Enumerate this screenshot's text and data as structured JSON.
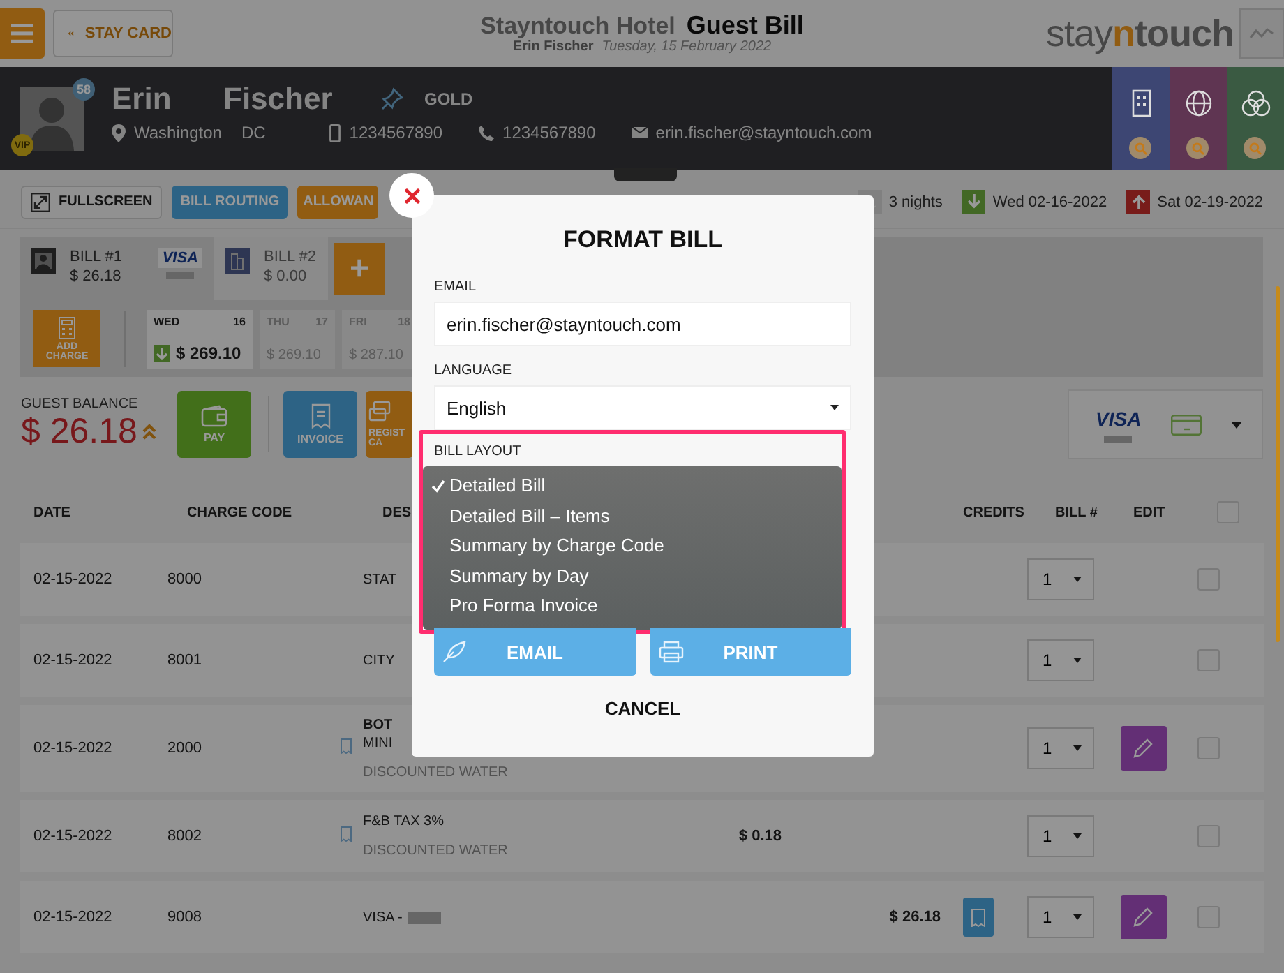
{
  "topbar": {
    "back_button": "STAY CARD",
    "hotel": "Stayntouch Hotel",
    "page_title": "Guest Bill",
    "guest_name": "Erin Fischer",
    "date": "Tuesday, 15 February 2022",
    "logo": [
      "stay",
      "n",
      "touch"
    ]
  },
  "guest": {
    "first_name": "Erin",
    "last_name": "Fischer",
    "age_badge": "58",
    "vip_badge": "VIP",
    "membership": "GOLD",
    "city": "Washington",
    "state": "DC",
    "mobile": "1234567890",
    "phone": "1234567890",
    "email": "erin.fischer@stayntouch.com"
  },
  "quick_tiles": [
    {
      "kind": "building",
      "color": "#3d4673"
    },
    {
      "kind": "globe",
      "color": "#5f3552"
    },
    {
      "kind": "circles",
      "color": "#3a5a42"
    }
  ],
  "toolbar": {
    "buttons": [
      {
        "label": "FULLSCREEN",
        "kind": "fullscreen"
      },
      {
        "label": "BILL ROUTING",
        "kind": "blue"
      },
      {
        "label": "ALLOWAN",
        "kind": "orange"
      }
    ],
    "nights": "3 nights",
    "arrival": "Wed 02-16-2022",
    "departure": "Sat 02-19-2022"
  },
  "bills": [
    {
      "label": "BILL #1",
      "amount": "$ 26.18",
      "selected": true,
      "kind": "guest",
      "card": "VISA"
    },
    {
      "label": "BILL #2",
      "amount": "$ 0.00",
      "selected": false,
      "kind": "company"
    }
  ],
  "add_bill": "+",
  "add_charge": "ADD CHARGE",
  "days": [
    {
      "day": "WED",
      "date": "16",
      "amount": "$ 269.10",
      "selected": true
    },
    {
      "day": "THU",
      "date": "17",
      "amount": "$ 269.10",
      "selected": false
    },
    {
      "day": "FRI",
      "date": "18",
      "amount": "$ 287.10",
      "selected": false
    }
  ],
  "balance": {
    "label": "GUEST BALANCE",
    "amount": "$ 26.18"
  },
  "actions": [
    {
      "label": "PAY",
      "kind": "pay"
    },
    {
      "label": "INVOICE",
      "kind": "invoice"
    },
    {
      "label": "REGIST CA",
      "kind": "register"
    }
  ],
  "payment_card": {
    "brand": "VISA"
  },
  "table": {
    "columns": [
      "DATE",
      "CHARGE CODE",
      "DES",
      "CREDITS",
      "BILL #",
      "EDIT"
    ],
    "select_all": {
      "checked": false
    },
    "rows": [
      {
        "date": "02-15-2022",
        "code": "8000",
        "description": [
          "STAT"
        ],
        "bill": "1",
        "receipt": false,
        "invoice": false,
        "editable": false,
        "checked": false
      },
      {
        "date": "02-15-2022",
        "code": "8001",
        "description": [
          "CITY"
        ],
        "bill": "1",
        "receipt": false,
        "invoice": false,
        "editable": false,
        "checked": false
      },
      {
        "date": "02-15-2022",
        "code": "2000",
        "description": [
          "BOT",
          "MINI"
        ],
        "note": "DISCOUNTED WATER",
        "bill": "1",
        "receipt": true,
        "invoice": false,
        "editable": true,
        "checked": false
      },
      {
        "date": "02-15-2022",
        "code": "8002",
        "description": [
          "F&B TAX 3%"
        ],
        "note": "DISCOUNTED WATER",
        "charge": "$ 0.18",
        "bill": "1",
        "receipt": true,
        "invoice": false,
        "editable": false,
        "checked": false
      },
      {
        "date": "02-15-2022",
        "code": "9008",
        "description": [
          "VISA -"
        ],
        "masked": true,
        "credit": "$ 26.18",
        "bill": "1",
        "receipt": false,
        "invoice": true,
        "editable": true,
        "checked": false
      }
    ]
  },
  "dialog": {
    "title": "FORMAT BILL",
    "email_label": "EMAIL",
    "email": "erin.fischer@stayntouch.com",
    "language_label": "LANGUAGE",
    "language": "English",
    "layout_label": "BILL LAYOUT",
    "layout_options": [
      {
        "label": "Detailed Bill",
        "selected": true
      },
      {
        "label": "Detailed Bill – Items",
        "selected": false
      },
      {
        "label": "Summary by Charge Code",
        "selected": false
      },
      {
        "label": "Summary by Day",
        "selected": false
      },
      {
        "label": "Pro Forma Invoice",
        "selected": false
      }
    ],
    "buttons": [
      {
        "label": "EMAIL",
        "kind": "email"
      },
      {
        "label": "PRINT",
        "kind": "print"
      }
    ],
    "cancel": "CANCEL"
  }
}
